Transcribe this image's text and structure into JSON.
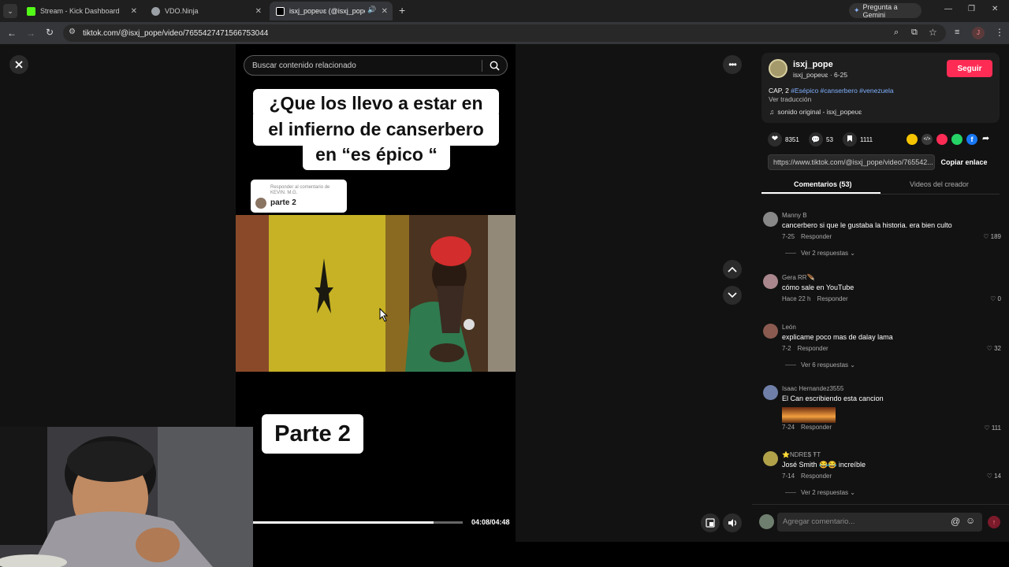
{
  "browser": {
    "tabs": [
      {
        "title": "Stream - Kick Dashboard",
        "color": "#53fc18"
      },
      {
        "title": "VDO.Ninja",
        "color": "#9aa0a6"
      },
      {
        "title": "isxj_popeʋɛ (@isxj_pope) | T",
        "color": "#ffffff"
      }
    ],
    "new_tab": "+",
    "gemini_label": "Pregunta a Gemini",
    "url": "tiktok.com/@isxj_pope/video/7655427471566753044",
    "profile_initial": "J"
  },
  "video": {
    "search_placeholder": "Buscar contenido relacionado",
    "caption_lines": [
      "¿Que los llevo a estar en",
      "el infierno de canserbero",
      "en “es épico “"
    ],
    "reply_header": "Responder al comentario de KEVIN. M.G.",
    "reply_text": "parte 2",
    "overlay_text": "Parte 2",
    "elapsed": "04:08",
    "duration": "04:48",
    "progress_fraction": 0.86
  },
  "author": {
    "username": "isxj_pope",
    "display": "isxj_popeʋɛ",
    "date": "6-25",
    "follow_label": "Seguir",
    "description": "CAP, 2",
    "hashtags": "#Esépico #canserbero #venezuela",
    "translate_label": "Ver traducción",
    "sound": "sonido original - isxj_popeʋɛ"
  },
  "stats": {
    "likes": "8351",
    "comments": "53",
    "saves": "1111"
  },
  "share": {
    "link": "https://www.tiktok.com/@isxj_pope/video/765542...",
    "copy_label": "Copiar enlace"
  },
  "panel_tabs": [
    "Comentarios (53)",
    "Videos del creador"
  ],
  "comments": [
    {
      "name": "Manny B",
      "text": "cancerbero si que le gustaba la historia. era bien culto",
      "date": "7-25",
      "reply": "Responder",
      "likes": "189",
      "more": "Ver 2 respuestas",
      "avatar": "#888888"
    },
    {
      "name": "Gera RR🪶",
      "text": "cómo sale en YouTube",
      "date": "Hace 22 h",
      "reply": "Responder",
      "likes": "0",
      "more": "",
      "avatar": "#a9878c"
    },
    {
      "name": "León",
      "text": "explicame poco mas de dalay lama",
      "date": "7-2",
      "reply": "Responder",
      "likes": "32",
      "more": "Ver 6 respuestas",
      "avatar": "#8a5a50"
    },
    {
      "name": "Isaac Hernandez3555",
      "text": "El Can escribiendo esta cancion",
      "date": "7-24",
      "reply": "Responder",
      "likes": "111",
      "more": "",
      "avatar": "#6f7fa8"
    },
    {
      "name": "⭐NDRE$ ŦT",
      "text": "José Smith 😂😂 increíble",
      "date": "7-14",
      "reply": "Responder",
      "likes": "14",
      "more": "Ver 2 respuestas",
      "avatar": "#b1a24a"
    }
  ],
  "comment_input": {
    "placeholder": "Agregar comentario...",
    "mention": "@"
  }
}
